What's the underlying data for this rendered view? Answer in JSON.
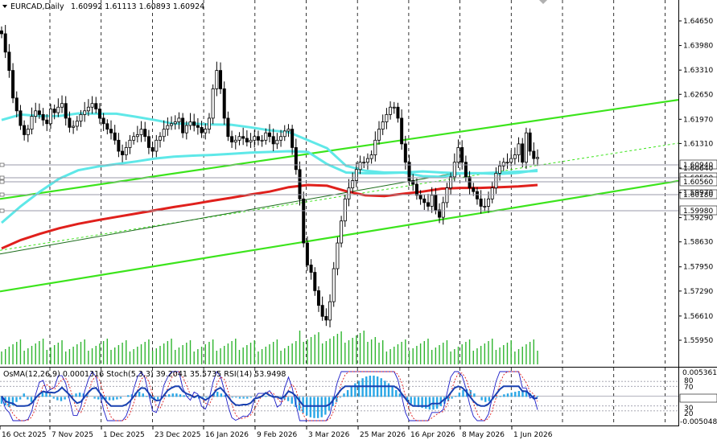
{
  "header": {
    "symbol": "EURCAD,Daily",
    "ohlc": "1.60992 1.61113 1.60893 1.60924"
  },
  "indicator_header": "OsMA(12,26,9) 0.0001316  Stoch(5,3,3) 39.2041 35.5735  RSI(14) 53.9498",
  "chart_data": {
    "type": "candlestick",
    "price_ticks": [
      "1.64650",
      "1.63980",
      "1.63310",
      "1.62650",
      "1.61970",
      "1.61310",
      "1.60640",
      "1.59970",
      "1.59290",
      "1.58630",
      "1.57950",
      "1.57290",
      "1.56610",
      "1.55950"
    ],
    "price_range": [
      1.5595,
      1.6465
    ],
    "date_labels": [
      "16 Oct 2025",
      "7 Nov 2025",
      "1 Dec 2025",
      "23 Dec 2025",
      "16 Jan 2026",
      "9 Feb 2026",
      "3 Mar 2026",
      "25 Mar 2026",
      "16 Apr 2026",
      "8 May 2026",
      "1 Jun 2026"
    ],
    "price_markers": [
      {
        "value": "1.60940",
        "color": "#c0c0c0"
      },
      {
        "value": "1.60590",
        "color": "#c0c0c0"
      },
      {
        "value": "1.60560",
        "color": "#c0c0c0"
      },
      {
        "value": "1.60180",
        "color": "#c0c0c0"
      },
      {
        "value": "1.59980",
        "color": "#c0c0c0"
      }
    ],
    "series": [
      {
        "kind": "moving-average",
        "color": "#e0201c",
        "points": [
          1.5845,
          1.5868,
          1.5885,
          1.59,
          1.5912,
          1.5922,
          1.5931,
          1.594,
          1.5949,
          1.5958,
          1.5966,
          1.5975,
          1.5983,
          1.5992,
          1.6,
          1.6012,
          1.6018,
          1.6016,
          1.6001,
          1.599,
          1.5988,
          1.5994,
          1.6,
          1.6008,
          1.601,
          1.601,
          1.6012,
          1.6014,
          1.6018
        ]
      },
      {
        "kind": "moving-average",
        "color": "#5ee8e8",
        "points": [
          1.5915,
          1.596,
          1.6,
          1.6035,
          1.6058,
          1.6068,
          1.6075,
          1.6082,
          1.609,
          1.6095,
          1.6098,
          1.61,
          1.6103,
          1.6106,
          1.6108,
          1.611,
          1.6108,
          1.6075,
          1.6052,
          1.605,
          1.605,
          1.6052,
          1.6055,
          1.6052,
          1.605,
          1.605,
          1.6052,
          1.6054,
          1.6056
        ]
      },
      {
        "kind": "moving-average",
        "color": "#60e8e8",
        "points": [
          1.6195,
          1.621,
          1.6206,
          1.6206,
          1.6213,
          1.6212,
          1.6212,
          1.6204,
          1.6195,
          1.6185,
          1.6185,
          1.6183,
          1.6182,
          1.6175,
          1.6167,
          1.6162,
          1.614,
          1.6118,
          1.607,
          1.6057,
          1.6052,
          1.6052,
          1.6042,
          1.604,
          1.605,
          1.605,
          1.6048,
          1.6051,
          1.6059
        ]
      }
    ],
    "channel_lines": [
      {
        "color": "#3ce41c",
        "from": 1.598,
        "to": 1.625
      },
      {
        "color": "#3ce41c",
        "from": 1.5728,
        "to": 1.6029
      },
      {
        "color": "#3ce41c",
        "from": 1.584,
        "to": 1.6132
      }
    ],
    "closes": [
      1.643,
      1.638,
      1.633,
      1.6255,
      1.622,
      1.618,
      1.6155,
      1.617,
      1.6205,
      1.622,
      1.621,
      1.6195,
      1.6185,
      1.6225,
      1.6215,
      1.623,
      1.624,
      1.62,
      1.6175,
      1.6178,
      1.6192,
      1.621,
      1.622,
      1.623,
      1.624,
      1.6225,
      1.62,
      1.6185,
      1.617,
      1.616,
      1.614,
      1.611,
      1.61,
      1.612,
      1.614,
      1.615,
      1.6155,
      1.617,
      1.615,
      1.612,
      1.611,
      1.614,
      1.615,
      1.617,
      1.618,
      1.6185,
      1.619,
      1.62,
      1.616,
      1.618,
      1.619,
      1.618,
      1.6175,
      1.616,
      1.617,
      1.62,
      1.628,
      1.633,
      1.628,
      1.62,
      1.615,
      1.6135,
      1.614,
      1.615,
      1.6145,
      1.6135,
      1.614,
      1.615,
      1.614,
      1.614,
      1.616,
      1.615,
      1.613,
      1.614,
      1.615,
      1.6165,
      1.617,
      1.612,
      1.606,
      1.598,
      1.586,
      1.58,
      1.578,
      1.573,
      1.569,
      1.566,
      1.565,
      1.57,
      1.579,
      1.586,
      1.592,
      1.598,
      1.601,
      1.603,
      1.606,
      1.608,
      1.608,
      1.609,
      1.61,
      1.614,
      1.617,
      1.619,
      1.621,
      1.623,
      1.623,
      1.62,
      1.613,
      1.608,
      1.603,
      1.602,
      1.599,
      1.598,
      1.597,
      1.596,
      1.599,
      1.595,
      1.593,
      1.597,
      1.601,
      1.604,
      1.608,
      1.612,
      1.608,
      1.604,
      1.601,
      1.6,
      1.598,
      1.596,
      1.596,
      1.598,
      1.601,
      1.605,
      1.607,
      1.608,
      1.608,
      1.609,
      1.61,
      1.613,
      1.608,
      1.616,
      1.611,
      1.609,
      1.6093
    ],
    "osma": [
      -0.0008,
      -0.001,
      -0.0012,
      -0.001,
      -0.0006,
      -0.0003,
      0.0004,
      -0.0003,
      -0.0006,
      -0.0004,
      0.0001,
      0.0005,
      0.0006,
      0.0002,
      -0.0002,
      -0.0004,
      -0.0005,
      -0.0003,
      -0.0001,
      0.0002,
      0.0004,
      0.0005,
      0.0004,
      0.0002,
      0.0,
      -0.0002,
      -0.0003,
      -0.0003,
      -0.0003,
      -0.0004,
      -0.0004,
      -0.0003,
      -0.0002,
      0.0,
      0.0002,
      0.0003,
      0.0005,
      0.0006,
      0.0004,
      0.0001,
      -0.0002,
      -0.0004,
      -0.0003,
      -0.0001,
      0.0002,
      0.0003,
      0.0004,
      0.0004,
      0.0003,
      0.0002,
      0.0001,
      0.0,
      -0.0001,
      -0.0002,
      -0.0002,
      -0.0001,
      0.0001,
      0.0004,
      0.0006,
      0.0004,
      0.0002,
      0.0,
      -0.0001,
      -0.0001,
      -0.0002,
      -0.0002,
      -0.0002,
      -0.0001,
      0.0,
      0.0,
      0.0001,
      0.0001,
      0.0,
      -0.0001,
      -0.0001,
      -0.0002,
      -0.0003,
      -0.0005,
      -0.0008,
      -0.0012,
      -0.0016,
      -0.0019,
      -0.0022,
      -0.0024,
      -0.0025,
      -0.0025,
      -0.0024,
      -0.0021,
      -0.0016,
      -0.0011,
      -0.0006,
      -0.0001,
      0.0004,
      0.0008,
      0.0012,
      0.0016,
      0.0019,
      0.0022,
      0.0024,
      0.0025,
      0.0025,
      0.0024,
      0.0022,
      0.0019,
      0.0016,
      0.0012,
      0.0008,
      0.0004,
      -0.0001,
      -0.0005,
      -0.0008,
      -0.001,
      -0.0012,
      -0.0013,
      -0.0014,
      -0.0015,
      -0.0015,
      -0.0014,
      -0.0011,
      -0.0008,
      -0.0005,
      -0.0002,
      0.0001,
      0.0005,
      0.0008,
      0.0009,
      0.0008,
      0.0004,
      0.0,
      -0.0004,
      -0.0006,
      -0.0005,
      -0.0003,
      -0.0001,
      0.0001,
      0.0003,
      0.0004,
      0.0005,
      0.0006,
      0.0007,
      0.0008,
      0.0006,
      0.0004,
      0.0002,
      0.0001
    ],
    "osma_range": [
      -0.005048,
      0.005361
    ],
    "indicator_scale_labels": [
      "0.00536146",
      "80",
      "70",
      "50",
      "30",
      "20",
      "-0.00504809"
    ],
    "indicator_levels": [
      80,
      70,
      50,
      30,
      20
    ]
  }
}
